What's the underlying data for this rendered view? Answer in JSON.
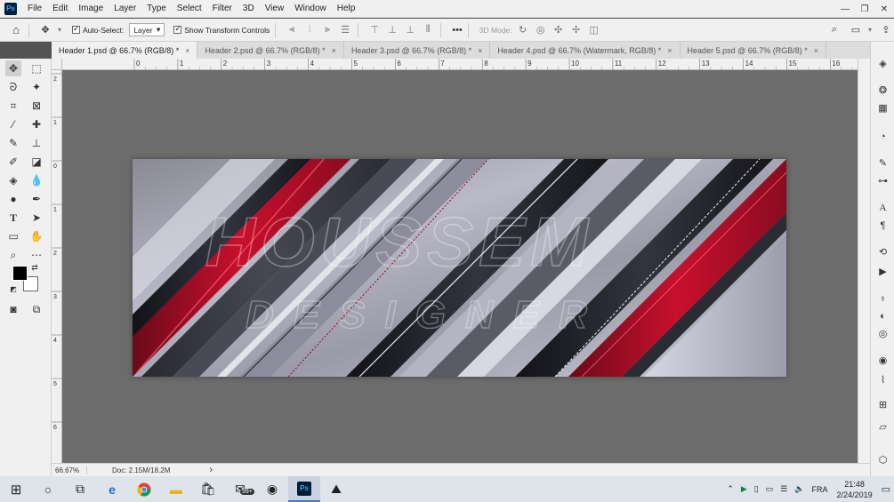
{
  "menubar": {
    "logo": "Ps",
    "items": [
      "File",
      "Edit",
      "Image",
      "Layer",
      "Type",
      "Select",
      "Filter",
      "3D",
      "View",
      "Window",
      "Help"
    ]
  },
  "window_controls": {
    "minimize": "—",
    "restore": "❐",
    "close": "✕"
  },
  "options_bar": {
    "auto_select_label": "Auto-Select:",
    "auto_select_checked": true,
    "auto_select_target": "Layer",
    "transform_controls_label": "Show Transform Controls",
    "transform_controls_checked": true,
    "more_label": "•••",
    "mode_3d_label": "3D Mode:"
  },
  "tabs": [
    {
      "label": "Header 1.psd @ 66.7% (RGB/8) *",
      "active": true
    },
    {
      "label": "Header 2.psd @ 66.7% (RGB/8) *",
      "active": false
    },
    {
      "label": "Header 3.psd @ 66.7% (RGB/8) *",
      "active": false
    },
    {
      "label": "Header 4.psd @ 66.7% (Watermark, RGB/8) *",
      "active": false
    },
    {
      "label": "Header 5.psd @ 66.7% (RGB/8) *",
      "active": false
    }
  ],
  "tab_close": "×",
  "ruler_h": [
    "0",
    "1",
    "2",
    "3",
    "4",
    "5",
    "6",
    "7",
    "8",
    "9",
    "10",
    "11",
    "12",
    "13",
    "14",
    "15",
    "16"
  ],
  "ruler_v": [
    "2",
    "1",
    "0",
    "1",
    "2",
    "3",
    "4",
    "5",
    "6"
  ],
  "status": {
    "zoom": "66.67%",
    "doc": "Doc: 2.15M/18.2M",
    "arrow": "›"
  },
  "artwork": {
    "line1": "HOUSSEM",
    "line2": "DESIGNER"
  },
  "colors": {
    "foreground": "#000000",
    "background": "#ffffff",
    "accent_red": "#c8102e"
  },
  "taskbar": {
    "tray_lang": "FRA",
    "time": "21:48",
    "date": "2/24/2019",
    "badge": "99+"
  }
}
